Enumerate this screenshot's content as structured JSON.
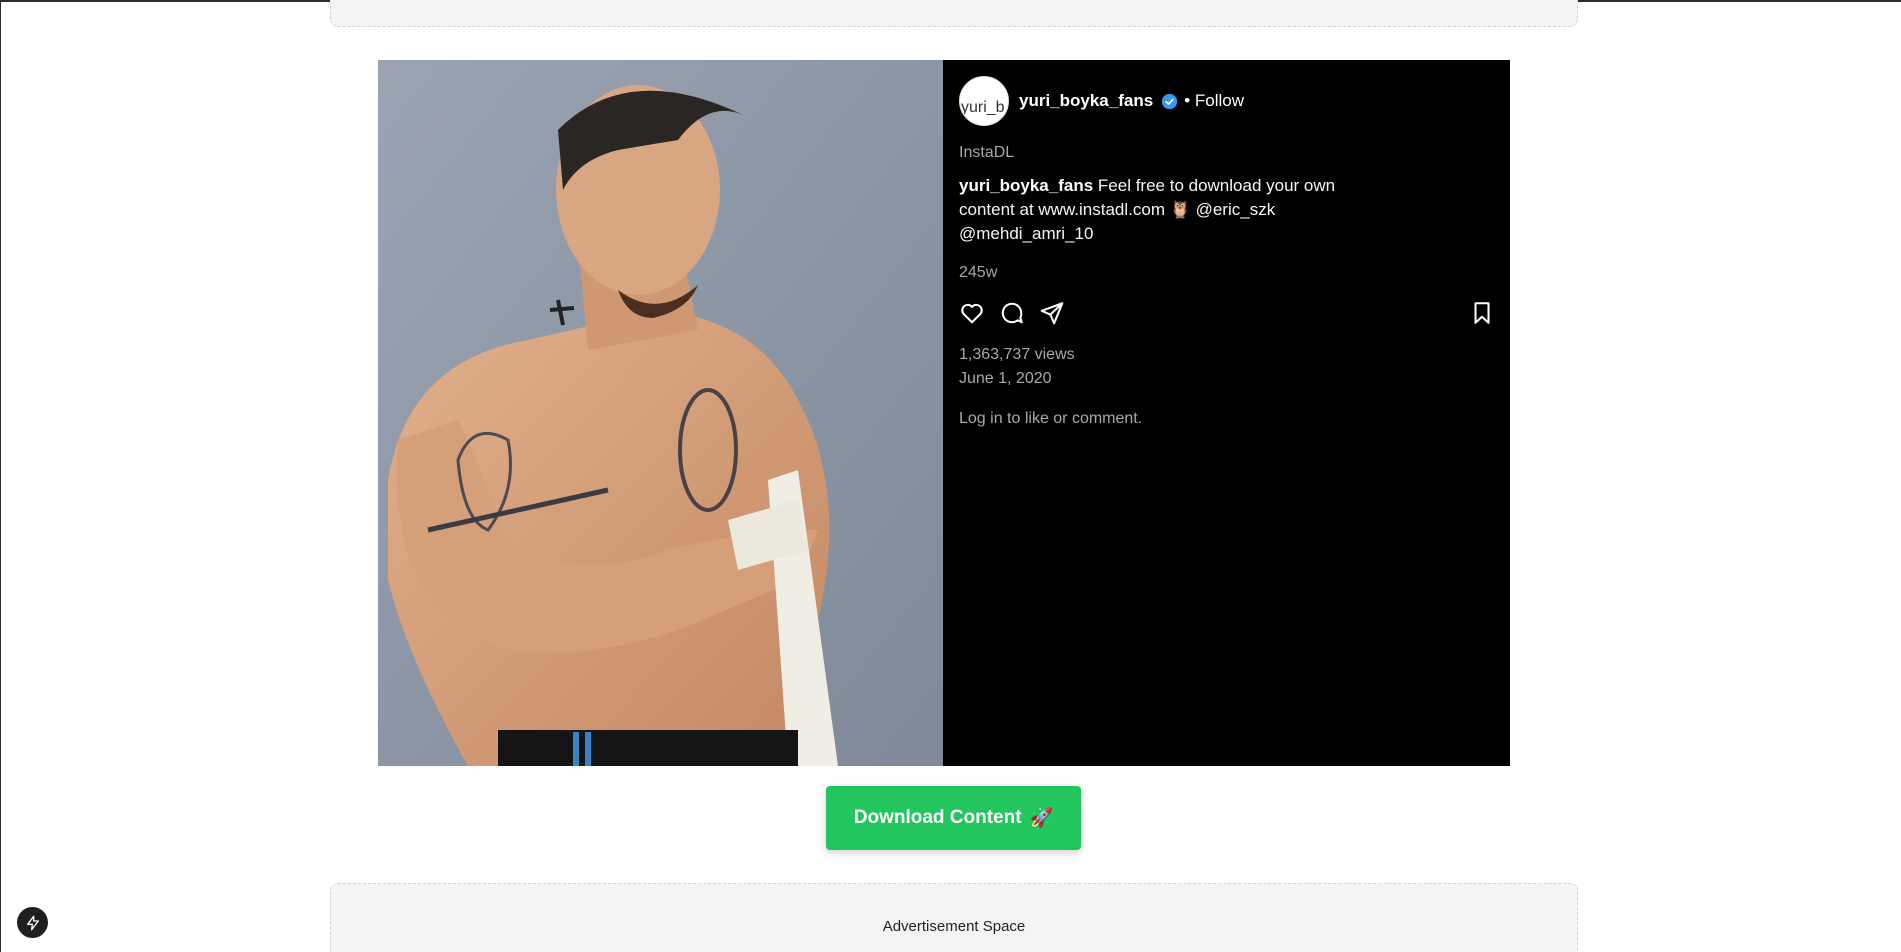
{
  "post": {
    "username": "yuri_boyka_fans",
    "avatar_alt": "yuri_b",
    "follow_label": "• Follow",
    "source": "InstaDL",
    "caption_user": "yuri_boyka_fans",
    "caption_text": " Feel free to download your own content at www.instadl.com 🦉 @eric_szk @mehdi_amri_10",
    "age": "245w",
    "views": "1,363,737 views",
    "date": "June 1, 2020",
    "login_prompt": "Log in to like or comment."
  },
  "icons": {
    "verified": "verified-badge-icon",
    "like": "heart-icon",
    "comment": "comment-icon",
    "share": "send-icon",
    "save": "bookmark-icon",
    "bolt": "lightning-icon"
  },
  "download_button": {
    "label": "Download Content",
    "emoji": "🚀"
  },
  "ads": {
    "bottom_label": "Advertisement Space"
  },
  "colors": {
    "accent_green": "#22c55e",
    "verified_blue": "#3897f0",
    "panel_bg": "#000000"
  }
}
